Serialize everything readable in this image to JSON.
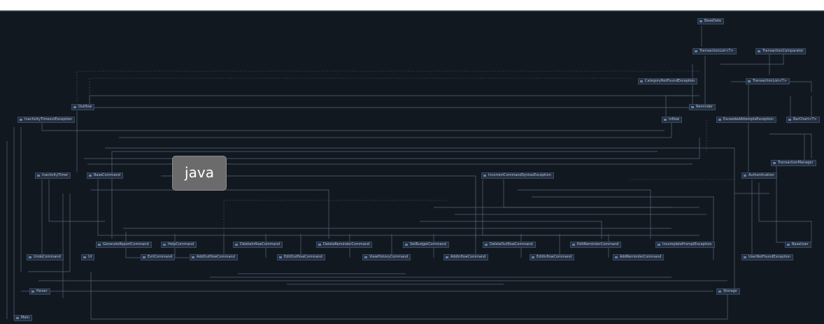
{
  "tag": "java",
  "nodes": {
    "BaseDate": "BaseDate",
    "TransactionList": "TransactionList<T>",
    "TransactionComparator": "TransactionComparator",
    "CategoryNotFoundException": "CategoryNotFoundException",
    "TransactionListT": "TransactionList<T>",
    "Outflow": "Outflow",
    "Reminder": "Reminder",
    "InactivityTimeoutException": "InactivityTimeoutException",
    "Inflow": "Inflow",
    "ExceededAttemptsException": "ExceededAttemptsException",
    "BarChart": "BarChart<T>",
    "TransactionManager": "TransactionManager",
    "InactivityTimer": "InactivityTimer",
    "BaseCommand": "BaseCommand",
    "IncorrectCommandSyntaxException": "IncorrectCommandSyntaxException",
    "Authentication": "Authentication",
    "GenerateReportCommand": "GenerateReportCommand",
    "HelpCommand": "HelpCommand",
    "DeleteInflowCommand": "DeleteInflowCommand",
    "DeleteReminderCommand": "DeleteReminderCommand",
    "SetBudgetCommand": "SetBudgetCommand",
    "DeleteOutflowCommand": "DeleteOutflowCommand",
    "EditReminderCommand": "EditReminderCommand",
    "IncompletePromptException": "IncompletePromptException",
    "BaseUser": "BaseUser",
    "UndoCommand": "UndoCommand",
    "UI": "UI",
    "ExitCommand": "ExitCommand",
    "AddOutflowCommand": "AddOutflowCommand",
    "EditOutflowCommand": "EditOutflowCommand",
    "ViewHistoryCommand": "ViewHistoryCommand",
    "AddInflowCommand": "AddInflowCommand",
    "EditInflowCommand": "EditInflowCommand",
    "AddReminderCommand": "AddReminderCommand",
    "UserNotFoundException": "UserNotFoundException",
    "Parser": "Parser",
    "Storage": "Storage",
    "Main": "Main"
  }
}
